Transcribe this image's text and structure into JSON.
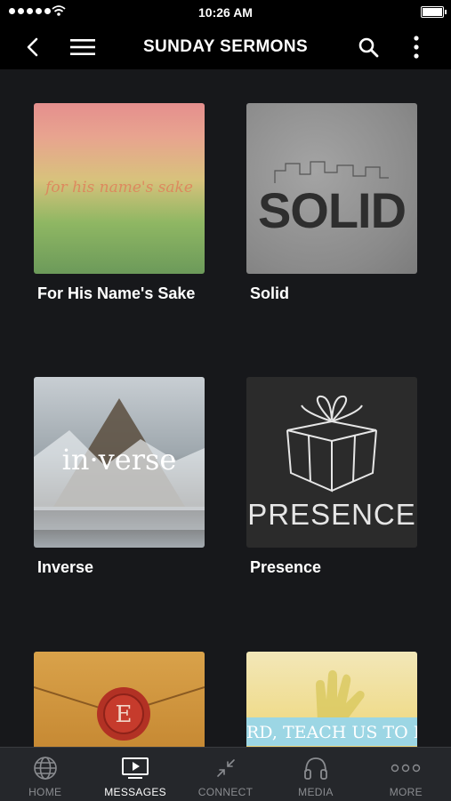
{
  "status": {
    "time": "10:26 AM"
  },
  "nav": {
    "title": "SUNDAY SERMONS"
  },
  "sermons": [
    {
      "title": "For His Name's Sake",
      "art_text": "for his name's sake"
    },
    {
      "title": "Solid",
      "art_text": "SOLID"
    },
    {
      "title": "Inverse",
      "art_text": "in·verse"
    },
    {
      "title": "Presence",
      "art_text": "PRESENCE"
    },
    {
      "title": "",
      "art_text": "E"
    },
    {
      "title": "",
      "art_text": "RD, TEACH US TO PR"
    }
  ],
  "tabs": [
    {
      "label": "HOME",
      "icon": "globe-icon"
    },
    {
      "label": "MESSAGES",
      "icon": "video-icon"
    },
    {
      "label": "CONNECT",
      "icon": "connect-arrows-icon"
    },
    {
      "label": "MEDIA",
      "icon": "headphones-icon"
    },
    {
      "label": "MORE",
      "icon": "more-dots-icon"
    }
  ],
  "active_tab": "MESSAGES",
  "colors": {
    "background": "#17181b",
    "bar": "#000000",
    "tabbar": "#25272b",
    "tab_inactive": "#8a8c90",
    "tab_active": "#ffffff"
  }
}
